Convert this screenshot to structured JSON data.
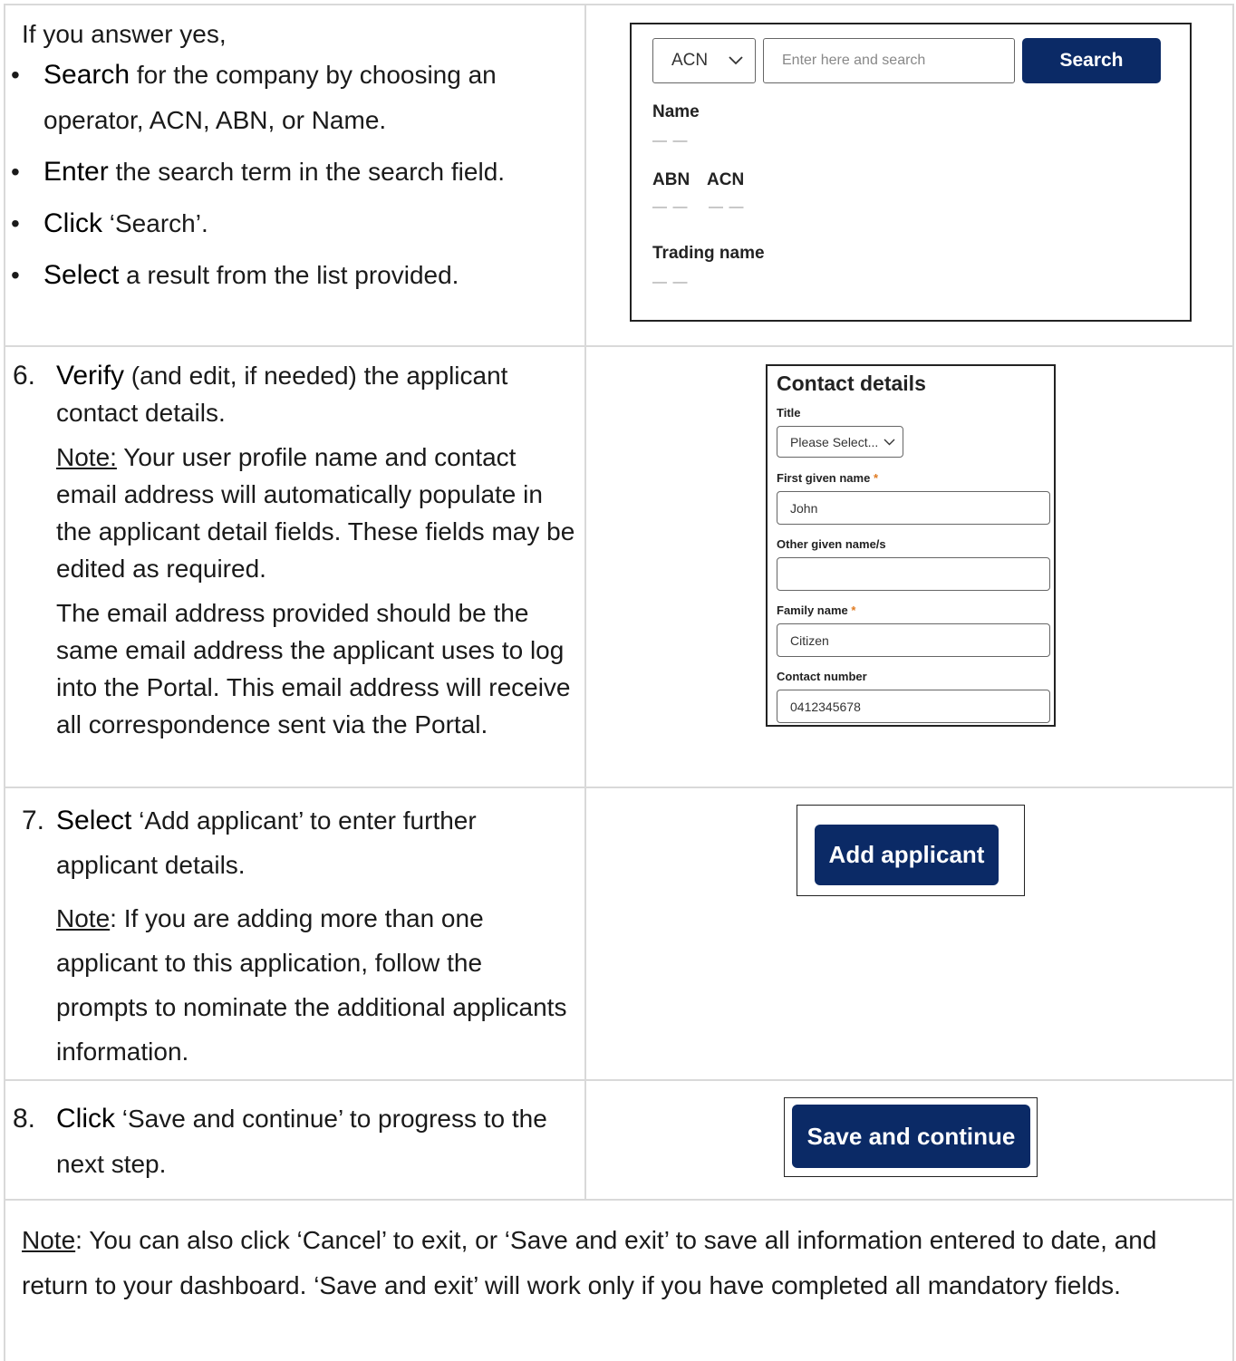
{
  "step5": {
    "intro": "If you answer yes,",
    "bullets": [
      {
        "keyword": "Search",
        "text": " for the company by choosing an operator, ACN, ABN, or Name."
      },
      {
        "keyword": "Enter",
        "text": " the search term in the search field."
      },
      {
        "keyword": "Click",
        "text": " ‘Search’."
      },
      {
        "keyword": "Select",
        "text": " a result from the list provided."
      }
    ],
    "mock": {
      "select_value": "ACN",
      "search_placeholder": "Enter here and search",
      "search_button": "Search",
      "name_label": "Name",
      "abn_label": "ABN",
      "acn_label": "ACN",
      "trading_label": "Trading name",
      "empty": "— —"
    }
  },
  "step6": {
    "number": "6.",
    "keyword": "Verify",
    "text": " (and edit, if needed) the applicant contact details.",
    "note_label": "Note:",
    "note_text": " Your user profile name and contact email address will automatically populate in the applicant detail fields. These fields may be edited as required.",
    "para2": "The email address provided should be the same email address the applicant uses to log into the Portal.  This email address will receive all correspondence sent via the Portal.",
    "mock": {
      "heading": "Contact details",
      "title_label": "Title",
      "title_value": "Please Select...",
      "first_label": "First given name",
      "first_value": "John",
      "other_label": "Other given name/s",
      "other_value": "",
      "family_label": "Family name",
      "family_value": "Citizen",
      "contact_label": "Contact number",
      "contact_value": "0412345678",
      "required_mark": "*"
    }
  },
  "step7": {
    "number": "7.",
    "keyword": "Select",
    "text": " ‘Add applicant’ to enter further applicant details.",
    "note_label": "Note",
    "note_text": ": If you are adding more than one applicant to this application, follow the prompts to nominate the additional applicants information.",
    "button": "Add applicant"
  },
  "step8": {
    "number": "8.",
    "keyword": "Click",
    "text": " ‘Save and continue’ to progress to the next step.",
    "button": "Save and continue"
  },
  "footer": {
    "note_label": "Note",
    "note_text": ": You can also click ‘Cancel’ to exit, or ‘Save and exit’ to save all information entered to date, and return to your dashboard.  ‘Save and exit’ will work only if you have completed all mandatory fields."
  },
  "colors": {
    "navy": "#0b2a66",
    "required": "#e07b22",
    "grid": "#d9d9d9"
  }
}
